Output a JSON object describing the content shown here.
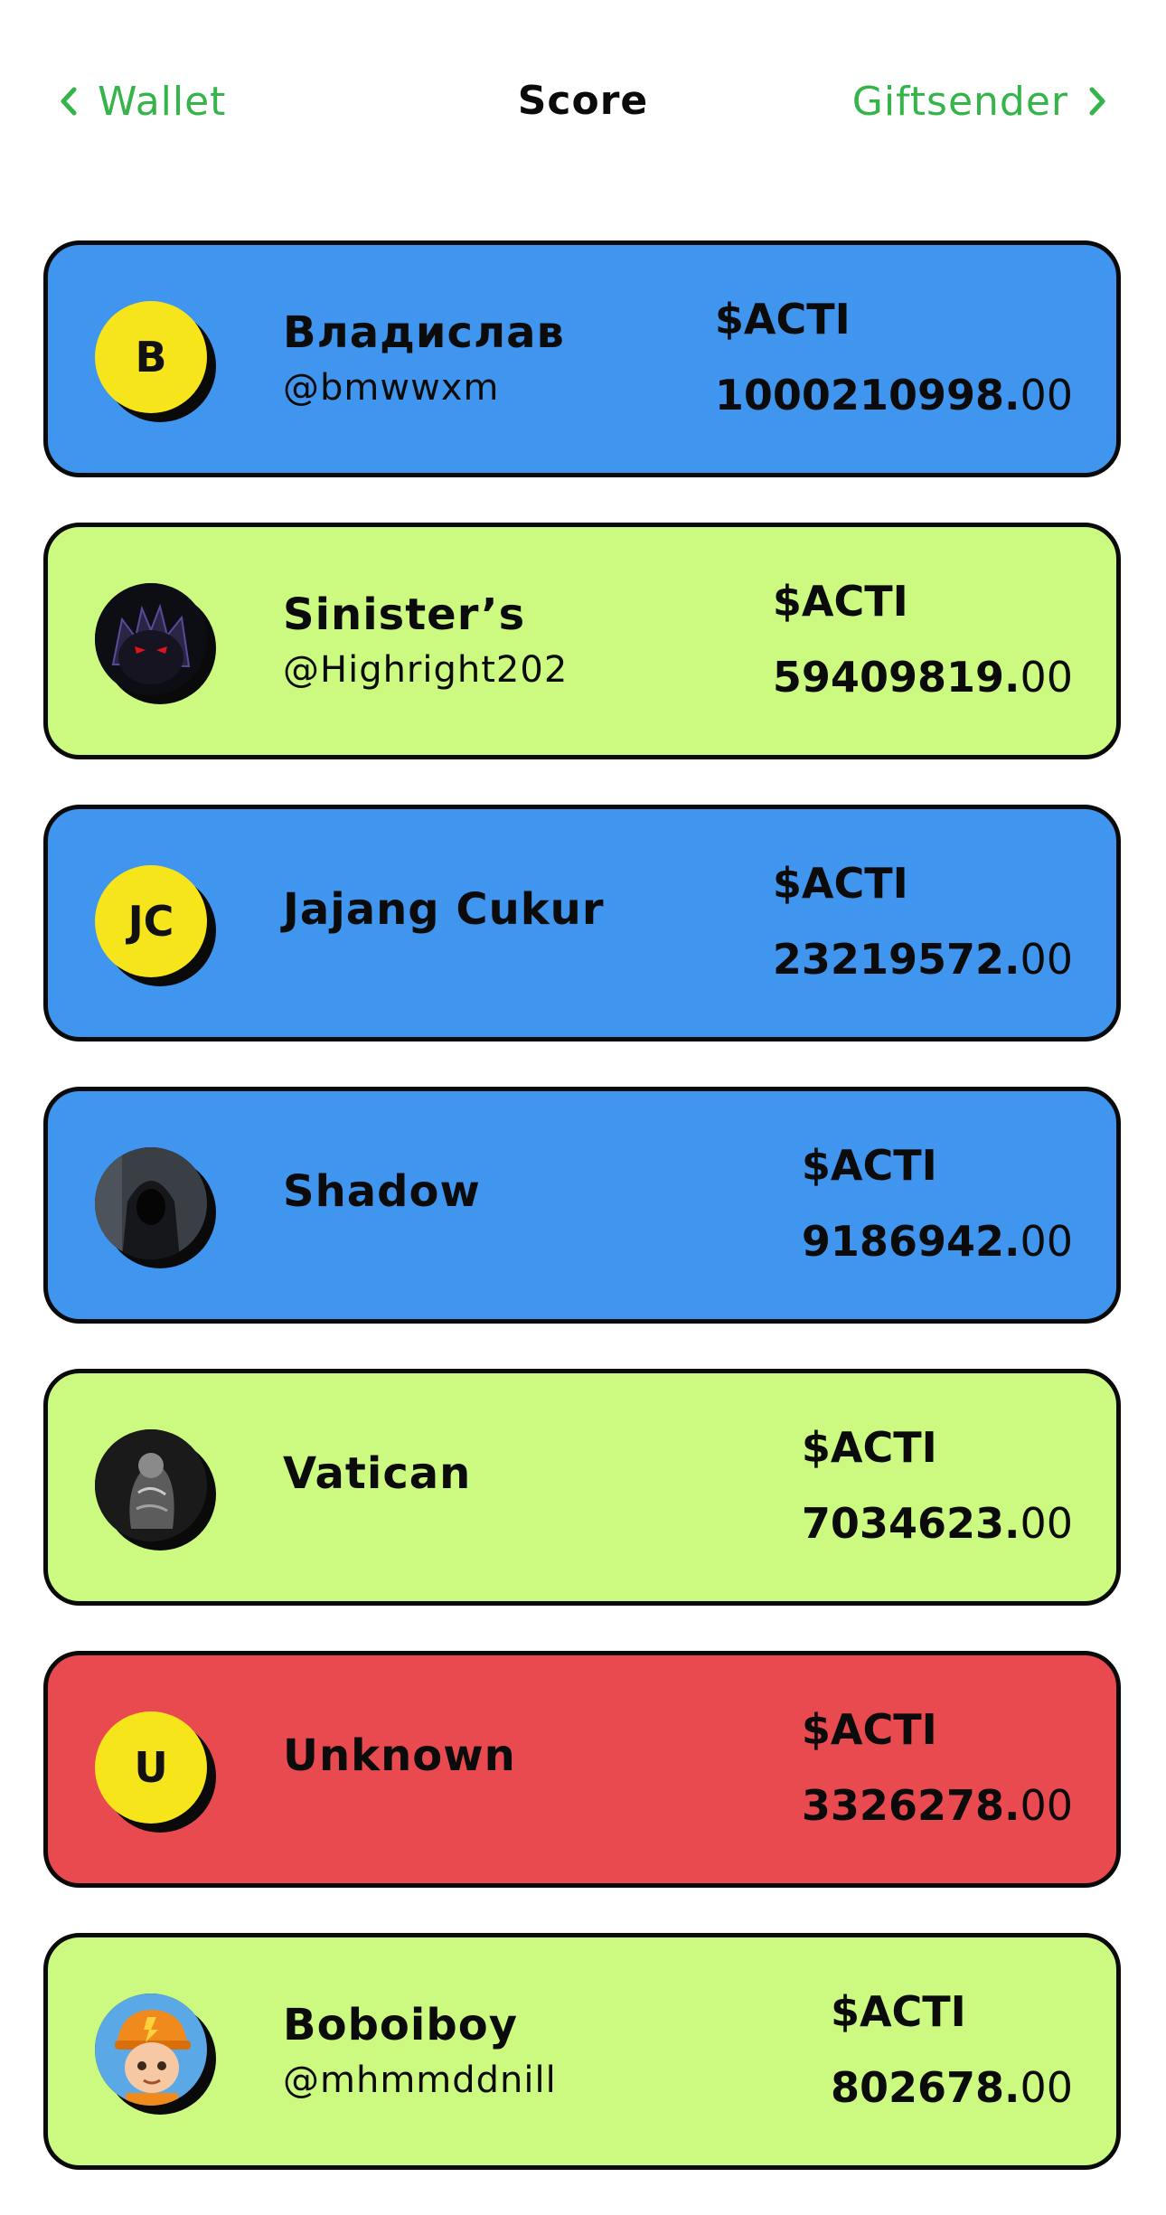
{
  "header": {
    "back_label": "Wallet",
    "title": "Score",
    "forward_label": "Giftsender"
  },
  "colors": {
    "accent_green": "#35b44a",
    "card_blue": "#4096ef",
    "card_lime": "#ccfa80",
    "card_red": "#e94a50",
    "avatar_yellow": "#f7e51c"
  },
  "entries": [
    {
      "name": "Владислав",
      "handle": "@bmwwxm",
      "currency": "$ACTI",
      "amount_int": "1000210998.",
      "amount_dec": "00",
      "color": "blue",
      "avatar_text": "B",
      "avatar_icon": ""
    },
    {
      "name": "Sinister’s",
      "handle": "@Highright202",
      "currency": "$ACTI",
      "amount_int": "59409819.",
      "amount_dec": "00",
      "color": "lime",
      "avatar_text": "",
      "avatar_icon": "demon-avatar-icon"
    },
    {
      "name": "Jajang Cukur",
      "handle": "",
      "currency": "$ACTI",
      "amount_int": "23219572.",
      "amount_dec": "00",
      "color": "blue",
      "avatar_text": "JC",
      "avatar_icon": ""
    },
    {
      "name": "Shadow",
      "handle": "",
      "currency": "$ACTI",
      "amount_int": "9186942.",
      "amount_dec": "00",
      "color": "blue",
      "avatar_text": "",
      "avatar_icon": "hooded-figure-avatar-icon"
    },
    {
      "name": "Vatican",
      "handle": "",
      "currency": "$ACTI",
      "amount_int": "7034623.",
      "amount_dec": "00",
      "color": "lime",
      "avatar_text": "",
      "avatar_icon": "statue-avatar-icon"
    },
    {
      "name": "Unknown",
      "handle": "",
      "currency": "$ACTI",
      "amount_int": "3326278.",
      "amount_dec": "00",
      "color": "red",
      "avatar_text": "U",
      "avatar_icon": ""
    },
    {
      "name": "Boboiboy",
      "handle": "@mhmmddnill",
      "currency": "$ACTI",
      "amount_int": "802678.",
      "amount_dec": "00",
      "color": "lime",
      "avatar_text": "",
      "avatar_icon": "cartoon-boy-avatar-icon"
    }
  ]
}
